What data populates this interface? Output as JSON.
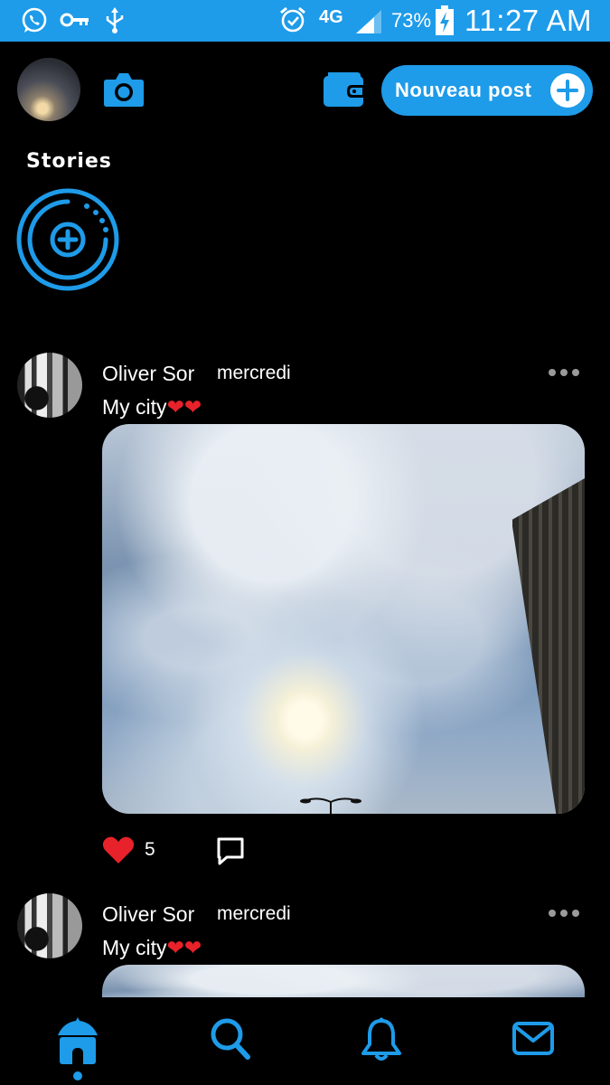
{
  "colors": {
    "accent": "#1e9be9",
    "background": "#000000",
    "heart": "#e8222a",
    "text": "#ffffff"
  },
  "status_bar": {
    "icons": [
      "whatsapp-icon",
      "key-icon",
      "usb-icon",
      "alarm-icon",
      "network-4g-lte-icon",
      "signal-icon",
      "battery-charging-icon"
    ],
    "network": "4G",
    "battery": "73%",
    "time": "11:27 AM"
  },
  "header": {
    "new_post_label": "Nouveau post",
    "icons": [
      "camera-icon",
      "wallet-icon",
      "plus-icon"
    ]
  },
  "stories": {
    "label": "Stories"
  },
  "posts": [
    {
      "author": "Oliver Sor",
      "date": "mercredi",
      "caption": "My city❤❤",
      "likes": "5"
    },
    {
      "author": "Oliver Sor",
      "date": "mercredi",
      "caption": "My city❤❤"
    }
  ],
  "bottom_nav": {
    "items": [
      "home-icon",
      "search-icon",
      "notifications-icon",
      "messages-icon"
    ],
    "active": "home-icon"
  }
}
